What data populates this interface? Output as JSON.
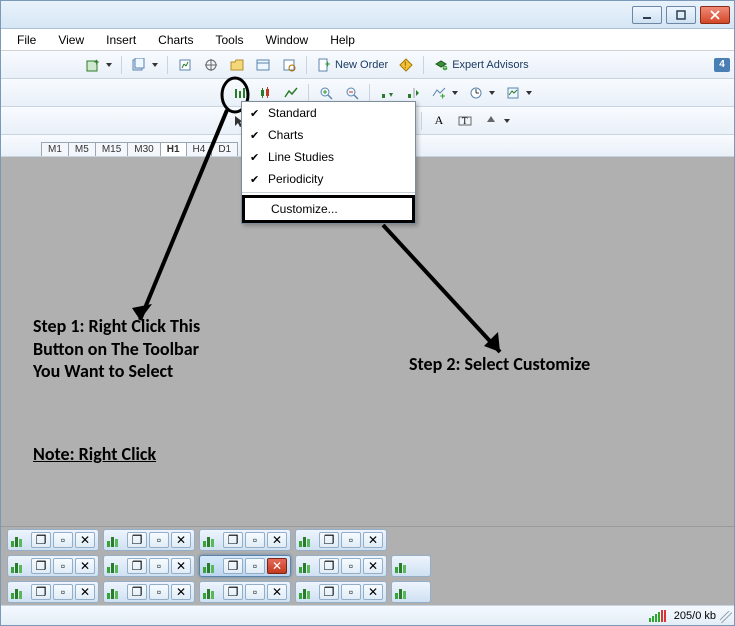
{
  "menubar": {
    "items": [
      "File",
      "View",
      "Insert",
      "Charts",
      "Tools",
      "Window",
      "Help"
    ]
  },
  "toolbar1": {
    "new_order": "New Order",
    "expert_advisors": "Expert Advisors",
    "badge": "4"
  },
  "period_tabs": [
    "M1",
    "M5",
    "M15",
    "M30",
    "H1",
    "H4",
    "D1"
  ],
  "active_period": "H1",
  "context_menu": {
    "items": [
      {
        "label": "Standard",
        "checked": true
      },
      {
        "label": "Charts",
        "checked": true
      },
      {
        "label": "Line Studies",
        "checked": true
      },
      {
        "label": "Periodicity",
        "checked": true
      }
    ],
    "customize": "Customize..."
  },
  "annotations": {
    "step1": "Step 1: Right Click This\nButton on The Toolbar\nYou Want to Select",
    "step2": "Step 2: Select Customize",
    "note": "Note: Right Click"
  },
  "statusbar": {
    "traffic": "205/0 kb"
  },
  "icons": {
    "new_order": "document-plus-icon",
    "expert": "hat-plus-icon"
  }
}
